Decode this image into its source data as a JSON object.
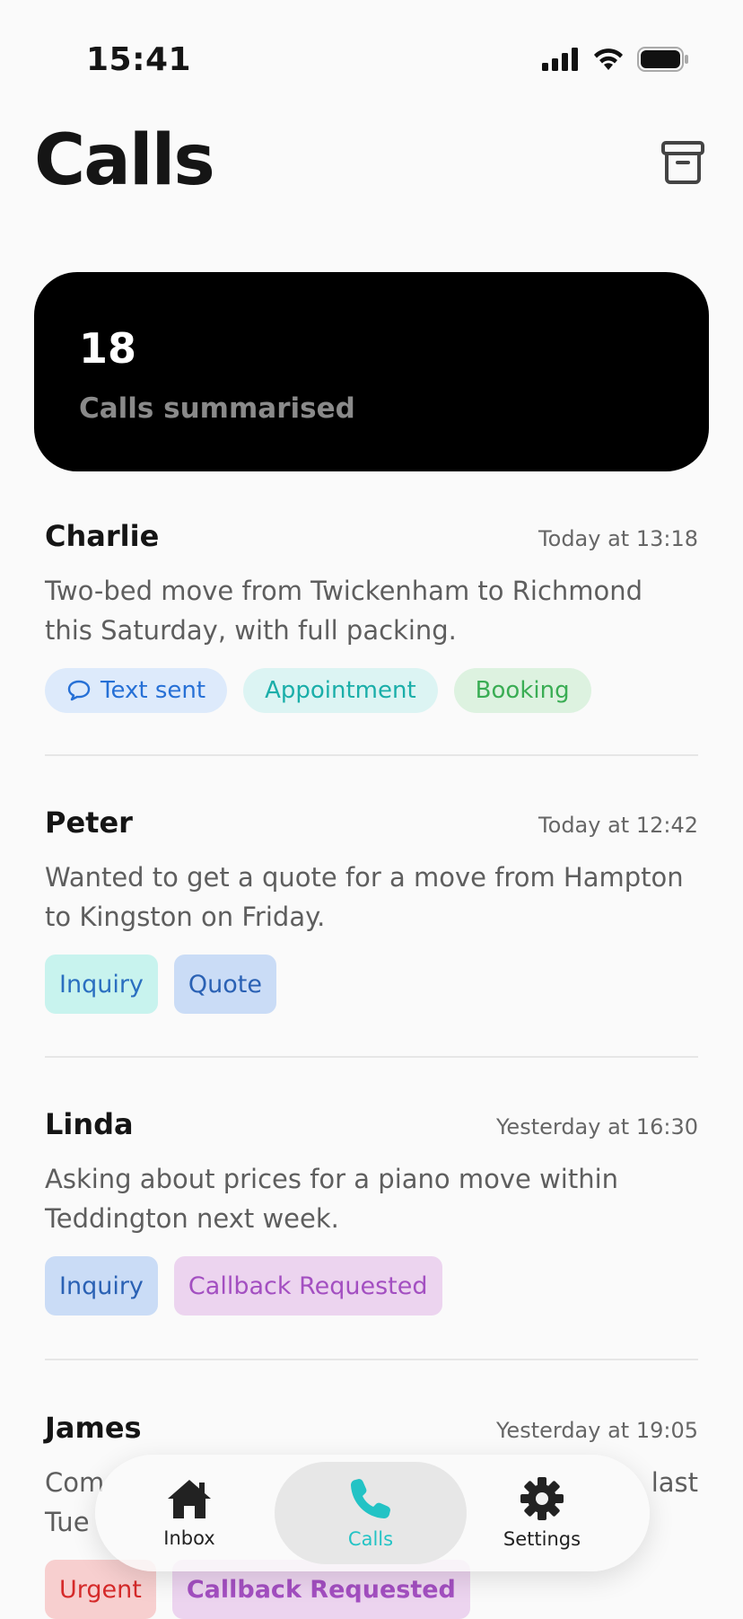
{
  "status": {
    "time": "15:41"
  },
  "header": {
    "title": "Calls"
  },
  "summary": {
    "count": "18",
    "label": "Calls summarised"
  },
  "calls": [
    {
      "name": "Charlie",
      "time": "Today at 13:18",
      "summary": "Two-bed move from Twickenham to Richmond this Saturday, with full packing.",
      "tags": [
        {
          "label": "Text sent",
          "icon": "speech-bubble-icon",
          "bg": "#ddeafb",
          "color": "#2670d6"
        },
        {
          "label": "Appointment",
          "bg": "#dcf4f3",
          "color": "#1aaea9"
        },
        {
          "label": "Booking",
          "bg": "#ddf2e0",
          "color": "#3aad54"
        }
      ]
    },
    {
      "name": "Peter",
      "time": "Today at 12:42",
      "summary": "Wanted to get a quote for a move from Hampton to Kingston on Friday.",
      "tags": [
        {
          "label": "Inquiry",
          "bg": "#c8f3ee",
          "color": "#2a6fc0"
        },
        {
          "label": "Quote",
          "bg": "#cadcf6",
          "color": "#2a61b4"
        }
      ]
    },
    {
      "name": "Linda",
      "time": "Yesterday at 16:30",
      "summary": "Asking about prices for a piano move within Teddington next week.",
      "tags": [
        {
          "label": "Inquiry",
          "bg": "#cadcf6",
          "color": "#2a61b4"
        },
        {
          "label": "Callback Requested",
          "bg": "#ecd4ef",
          "color": "#a34fc1"
        }
      ]
    },
    {
      "name": "James",
      "time": "Yesterday at 19:05",
      "summary_start": "Com",
      "summary_end": "last",
      "summary_line2": "Tue",
      "tags": [
        {
          "label": "Urgent",
          "bg": "#f7cfcf",
          "color": "#d52a2a"
        },
        {
          "label": "Callback Requested",
          "bg": "#ecd4ef",
          "color": "#a34fc1"
        }
      ]
    }
  ],
  "tabbar": {
    "tabs": [
      {
        "label": "Inbox",
        "icon": "house-icon",
        "active": false
      },
      {
        "label": "Calls",
        "icon": "phone-icon",
        "active": true
      },
      {
        "label": "Settings",
        "icon": "gear-icon",
        "active": false
      }
    ]
  },
  "colors": {
    "accent": "#23c3c5",
    "card": "#000000",
    "background": "#fafafa"
  }
}
